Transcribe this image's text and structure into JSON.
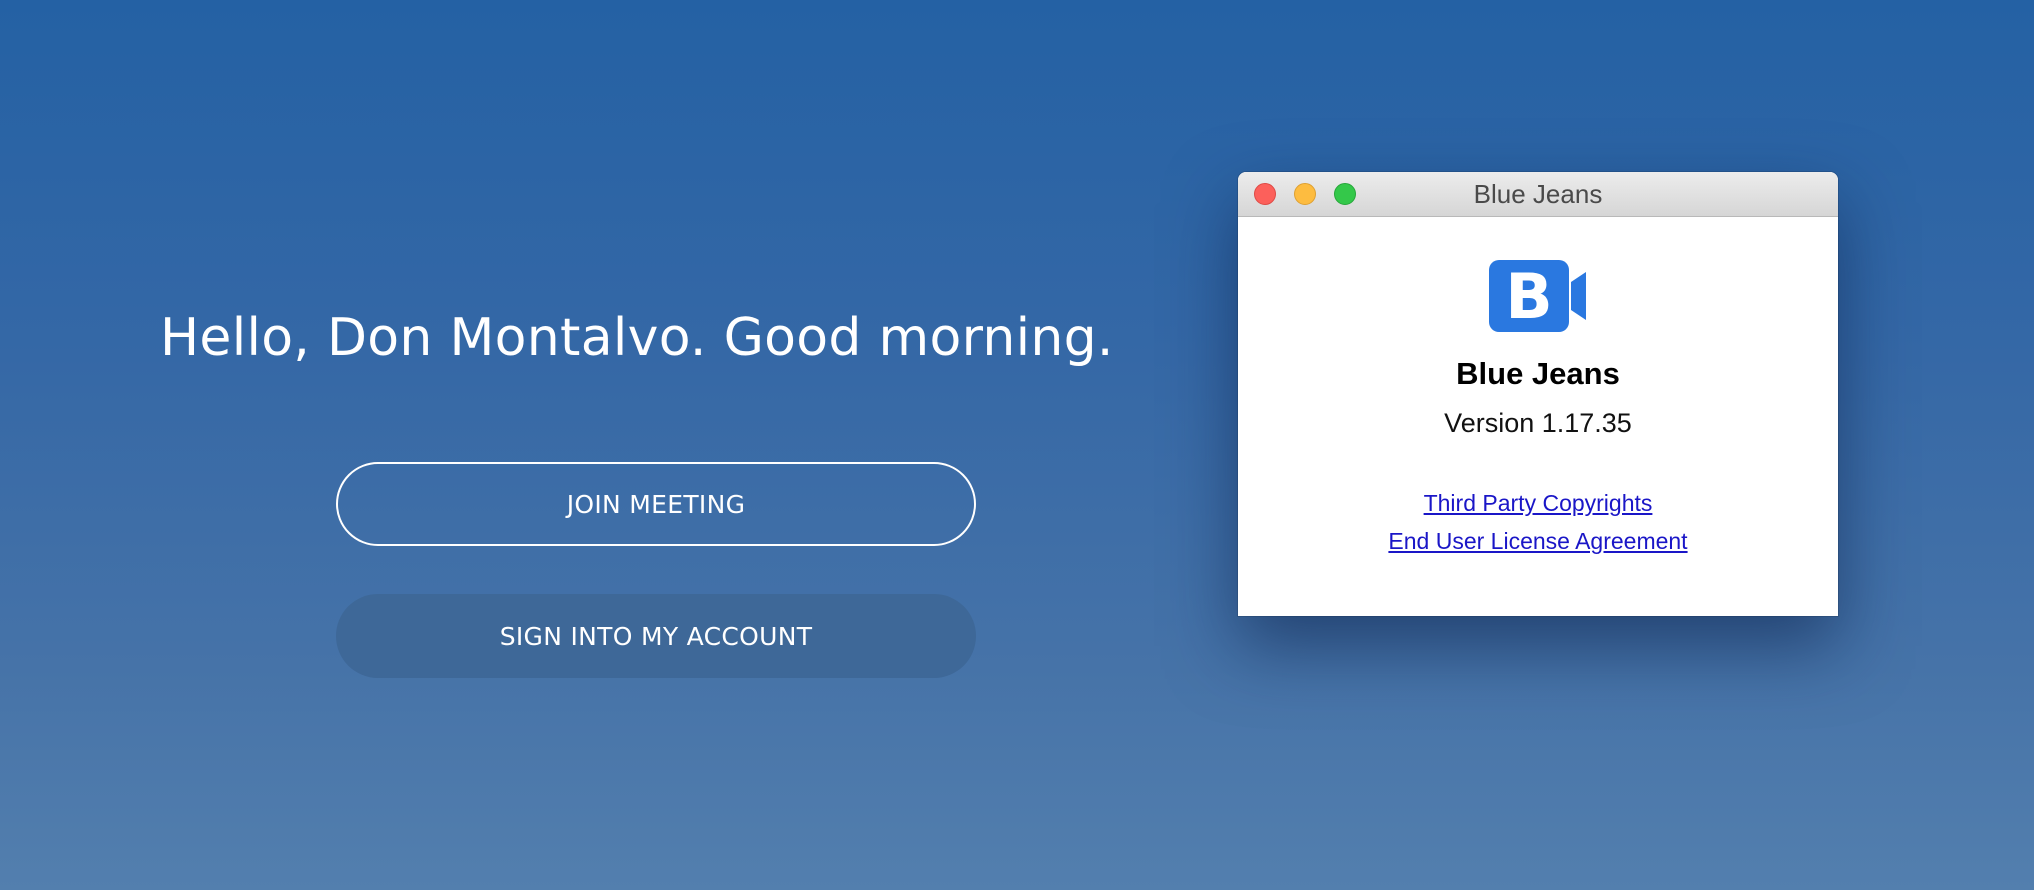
{
  "greeting": "Hello, Don Montalvo. Good morning.",
  "buttons": {
    "join_meeting": "JOIN MEETING",
    "sign_in": "SIGN INTO MY ACCOUNT"
  },
  "about_window": {
    "title": "Blue Jeans",
    "app_name": "Blue Jeans",
    "version": "Version 1.17.35",
    "links": {
      "third_party": "Third Party Copyrights",
      "eula": "End User License Agreement"
    },
    "logo_letter": "B",
    "logo_icon": "bluejeans-camera-logo-icon"
  },
  "colors": {
    "background_top": "#2461a4",
    "background_bottom": "#537fae",
    "logo_blue": "#2a78e0",
    "link_color": "#1a16c7"
  }
}
